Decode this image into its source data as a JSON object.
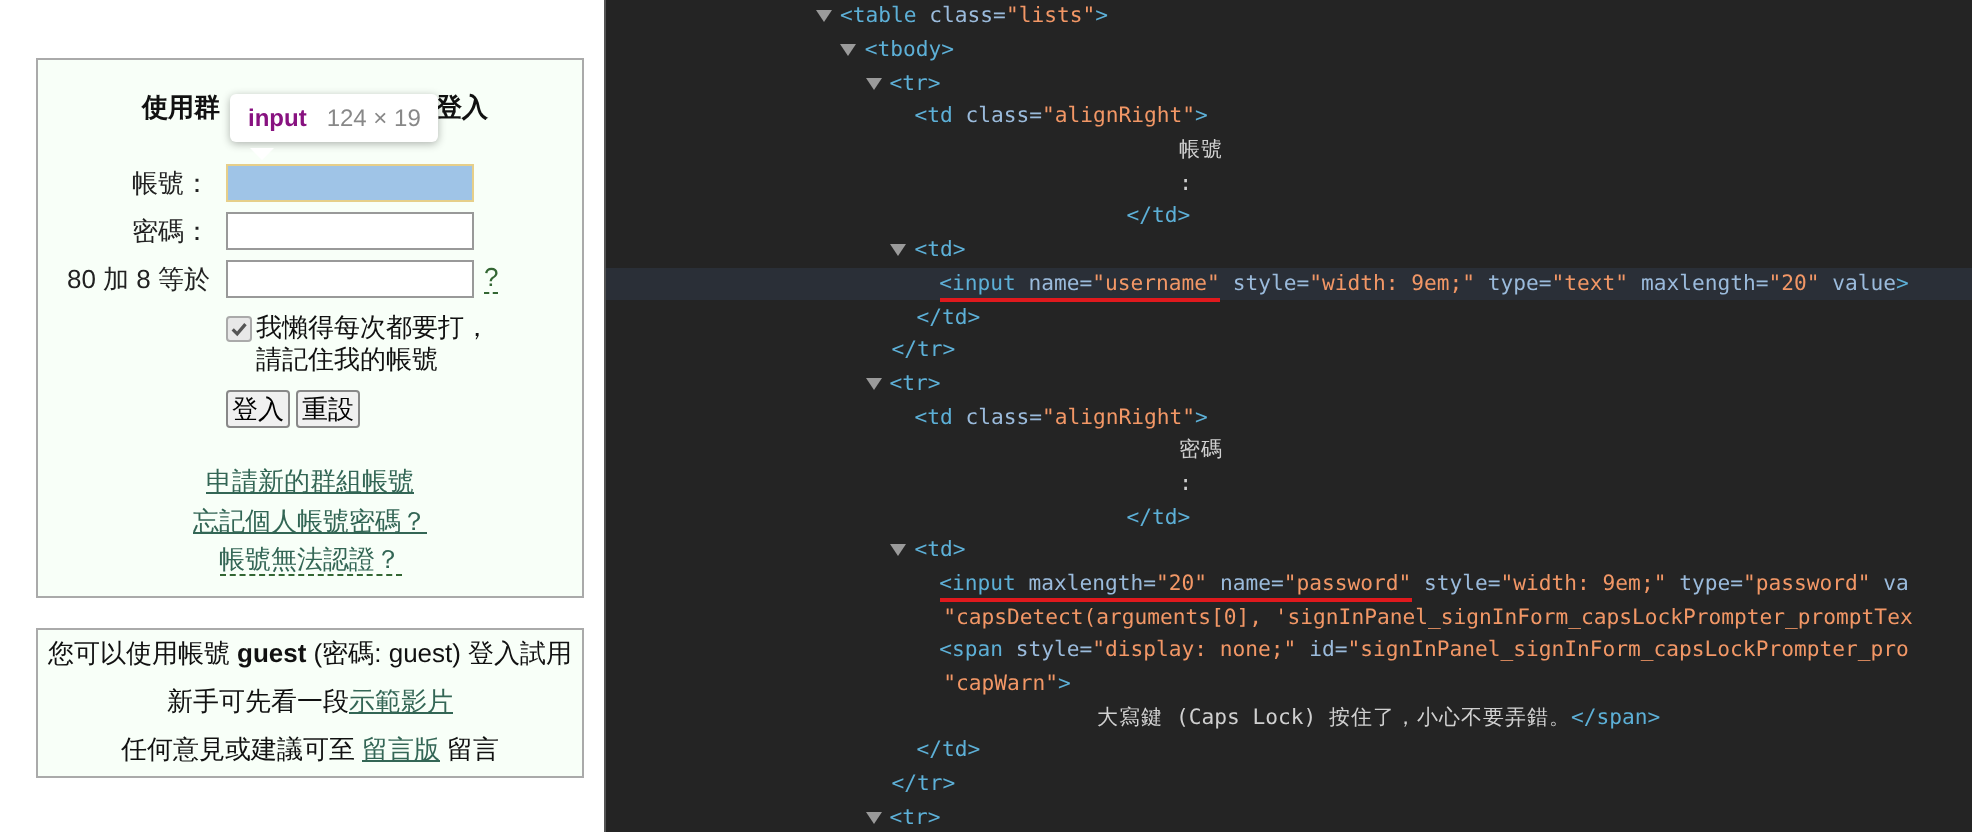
{
  "login_panel": {
    "title_parts": [
      "使用群",
      "登入"
    ],
    "tooltip": {
      "tag": "input",
      "size": "124 × 19"
    },
    "fields": [
      {
        "label": "帳號：",
        "highlighted": true
      },
      {
        "label": "密碼：",
        "highlighted": false
      },
      {
        "label": "80 加 8 等於",
        "highlighted": false,
        "help": "?"
      }
    ],
    "remember": {
      "checked": true,
      "label": "我懶得每次都要打，請記住我的帳號"
    },
    "buttons": [
      "登入",
      "重設"
    ],
    "links": [
      {
        "text": "申請新的群組帳號",
        "dashed": false
      },
      {
        "text": "忘記個人帳號密碼？",
        "dashed": false
      },
      {
        "text": "帳號無法認證？",
        "dashed": true
      }
    ]
  },
  "info_panel": {
    "guest_note": "您可以使用帳號 **guest** (密碼: guest) 登入試用",
    "video_note": {
      "text": "新手可先看一段",
      "link": "示範影片"
    },
    "feedback_note": {
      "before": "任何意見或建議可至 ",
      "link": "留言版",
      "after": " 留言"
    }
  },
  "elements_panel": {
    "lines": [
      {
        "kind": "element",
        "selected": false,
        "expanded": true,
        "tokens": [
          {
            "kind": "tag",
            "text": "<table"
          },
          {
            "kind": "attr",
            "text": " class="
          },
          {
            "kind": "value",
            "text": "\"lists\""
          },
          {
            "kind": "tag",
            "text": ">"
          }
        ],
        "children": [
          {
            "kind": "element",
            "selected": false,
            "expanded": true,
            "tokens": [
              {
                "kind": "tag",
                "text": "<tbody>"
              }
            ],
            "children": [
              {
                "kind": "element",
                "selected": false,
                "expanded": true,
                "tokens": [
                  {
                    "kind": "tag",
                    "text": "<tr>"
                  }
                ],
                "children": [
                  {
                    "kind": "element",
                    "selected": false,
                    "tokens": [
                      {
                        "kind": "tag",
                        "text": "<td"
                      },
                      {
                        "kind": "attr",
                        "text": " class="
                      },
                      {
                        "kind": "value",
                        "text": "\"alignRight\""
                      },
                      {
                        "kind": "tag",
                        "text": ">"
                      }
                    ],
                    "children": [
                      {
                        "kind": "text",
                        "selected": false,
                        "tokens": [
                          {
                            "kind": "text",
                            "text": "帳號"
                          }
                        ]
                      },
                      {
                        "kind": "text",
                        "selected": false,
                        "tokens": [
                          {
                            "kind": "text",
                            "text": ":"
                          }
                        ]
                      }
                    ]
                  },
                  {
                    "kind": "close_after_text",
                    "selected": false,
                    "tokens": [
                      {
                        "kind": "tag",
                        "text": "</td>"
                      }
                    ]
                  },
                  {
                    "kind": "element",
                    "selected": false,
                    "expanded": true,
                    "tokens": [
                      {
                        "kind": "tag",
                        "text": "<td>"
                      }
                    ],
                    "children": [
                      {
                        "kind": "element",
                        "selected": true,
                        "underlined": [
                          {
                            "kind": "tag",
                            "text": "<input"
                          },
                          {
                            "kind": "attr",
                            "text": " name="
                          },
                          {
                            "kind": "value",
                            "text": "\"username\""
                          }
                        ],
                        "tokens": [
                          {
                            "kind": "attr",
                            "text": " style="
                          },
                          {
                            "kind": "value",
                            "text": "\"width: 9em;\""
                          },
                          {
                            "kind": "attr",
                            "text": " type="
                          },
                          {
                            "kind": "value",
                            "text": "\"text\""
                          },
                          {
                            "kind": "attr",
                            "text": " maxlength="
                          },
                          {
                            "kind": "value",
                            "text": "\"20\""
                          },
                          {
                            "kind": "attr",
                            "text": " value"
                          },
                          {
                            "kind": "tag",
                            "text": ">"
                          }
                        ]
                      }
                    ]
                  },
                  {
                    "kind": "close",
                    "selected": false,
                    "tokens": [
                      {
                        "kind": "tag",
                        "text": "</td>"
                      }
                    ]
                  }
                ]
              },
              {
                "kind": "close",
                "selected": false,
                "tokens": [
                  {
                    "kind": "tag",
                    "text": "</tr>"
                  }
                ]
              },
              {
                "kind": "element",
                "selected": false,
                "expanded": true,
                "tokens": [
                  {
                    "kind": "tag",
                    "text": "<tr>"
                  }
                ],
                "children": [
                  {
                    "kind": "element",
                    "selected": false,
                    "tokens": [
                      {
                        "kind": "tag",
                        "text": "<td"
                      },
                      {
                        "kind": "attr",
                        "text": " class="
                      },
                      {
                        "kind": "value",
                        "text": "\"alignRight\""
                      },
                      {
                        "kind": "tag",
                        "text": ">"
                      }
                    ],
                    "children": [
                      {
                        "kind": "text",
                        "selected": false,
                        "tokens": [
                          {
                            "kind": "text",
                            "text": "密碼"
                          }
                        ]
                      },
                      {
                        "kind": "text",
                        "selected": false,
                        "tokens": [
                          {
                            "kind": "text",
                            "text": ":"
                          }
                        ]
                      }
                    ]
                  },
                  {
                    "kind": "close_after_text",
                    "selected": false,
                    "tokens": [
                      {
                        "kind": "tag",
                        "text": "</td>"
                      }
                    ]
                  },
                  {
                    "kind": "element",
                    "selected": false,
                    "expanded": true,
                    "tokens": [
                      {
                        "kind": "tag",
                        "text": "<td>"
                      }
                    ],
                    "children": [
                      {
                        "kind": "element",
                        "selected": false,
                        "underlined": [
                          {
                            "kind": "tag",
                            "text": "<input"
                          },
                          {
                            "kind": "attr",
                            "text": " maxlength="
                          },
                          {
                            "kind": "value",
                            "text": "\"20\""
                          },
                          {
                            "kind": "attr",
                            "text": " name="
                          },
                          {
                            "kind": "value",
                            "text": "\"password\""
                          }
                        ],
                        "tokens": [
                          {
                            "kind": "attr",
                            "text": " style="
                          },
                          {
                            "kind": "value",
                            "text": "\"width: 9em;\""
                          },
                          {
                            "kind": "attr",
                            "text": " type="
                          },
                          {
                            "kind": "value",
                            "text": "\"password\""
                          },
                          {
                            "kind": "attr",
                            "text": " va"
                          }
                        ]
                      },
                      {
                        "kind": "continuation",
                        "selected": false,
                        "tokens": [
                          {
                            "kind": "value",
                            "text": "\"capsDetect(arguments[0], 'signInPanel_signInForm_capsLockPrompter_promptTex"
                          }
                        ]
                      },
                      {
                        "kind": "element",
                        "selected": false,
                        "tokens": [
                          {
                            "kind": "tag",
                            "text": "<span"
                          },
                          {
                            "kind": "attr",
                            "text": " style="
                          },
                          {
                            "kind": "value",
                            "text": "\"display: none;\""
                          },
                          {
                            "kind": "attr",
                            "text": " id="
                          },
                          {
                            "kind": "value",
                            "text": "\"signInPanel_signInForm_capsLockPrompter_pro"
                          }
                        ]
                      },
                      {
                        "kind": "continuation",
                        "selected": false,
                        "tokens": [
                          {
                            "kind": "value",
                            "text": "\"capWarn\""
                          },
                          {
                            "kind": "tag",
                            "text": ">"
                          }
                        ]
                      },
                      {
                        "kind": "inline_text",
                        "selected": false,
                        "tokens": [
                          {
                            "kind": "text",
                            "text": "大寫鍵 (Caps Lock) 按住了，小心不要弄錯。"
                          },
                          {
                            "kind": "tag",
                            "text": "</span>"
                          }
                        ]
                      }
                    ]
                  },
                  {
                    "kind": "close",
                    "selected": false,
                    "tokens": [
                      {
                        "kind": "tag",
                        "text": "</td>"
                      }
                    ]
                  }
                ]
              },
              {
                "kind": "close",
                "selected": false,
                "tokens": [
                  {
                    "kind": "tag",
                    "text": "</tr>"
                  }
                ]
              },
              {
                "kind": "element",
                "selected": false,
                "expanded": true,
                "tokens": [
                  {
                    "kind": "tag",
                    "text": "<tr>"
                  }
                ]
              }
            ]
          }
        ]
      }
    ]
  }
}
